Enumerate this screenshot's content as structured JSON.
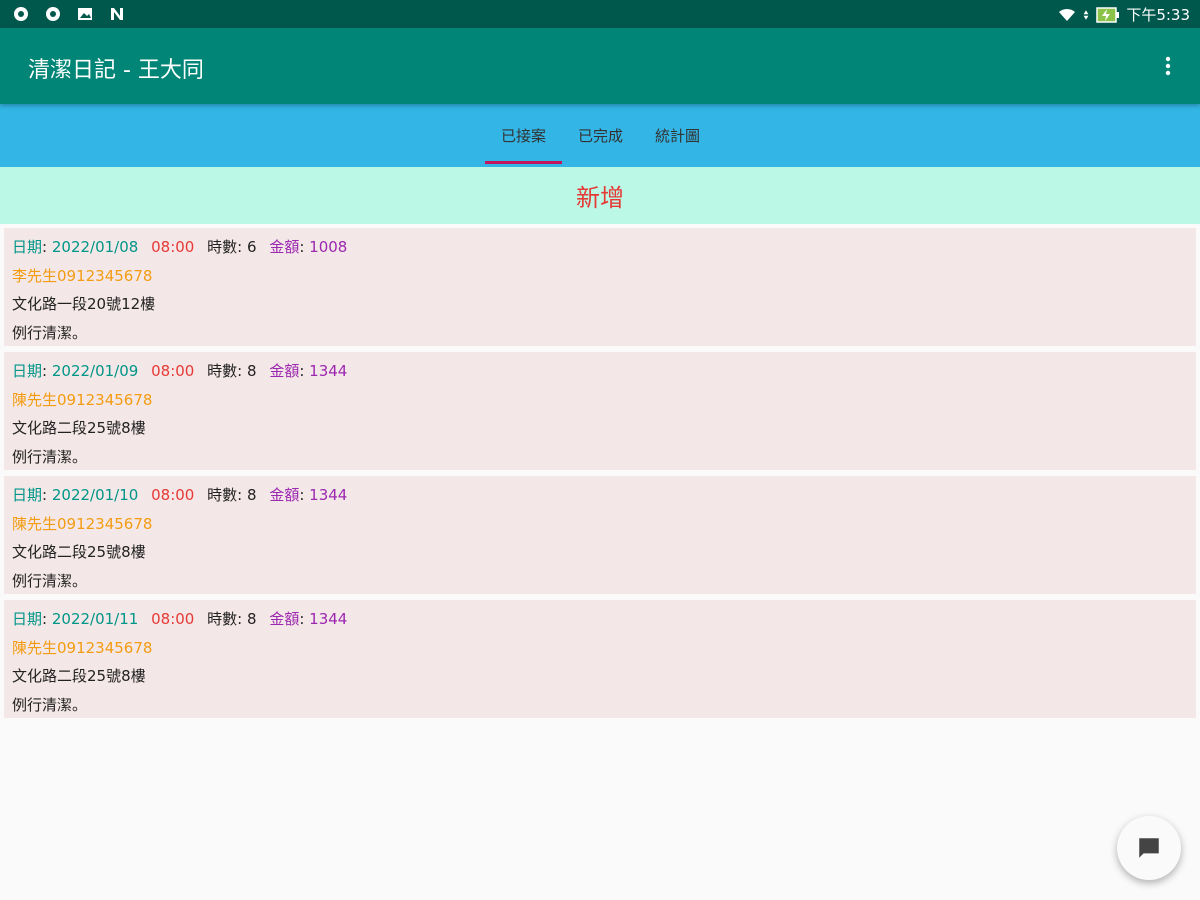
{
  "status_bar": {
    "time": "下午5:33",
    "left_icons": [
      "vpn-icon",
      "vpn-icon",
      "image-icon",
      "n-icon"
    ],
    "right_icons": [
      "wifi-icon",
      "signal-icon",
      "battery-charging-icon"
    ]
  },
  "app_bar": {
    "title": "清潔日記 - 王大同",
    "menu_icon": "more-vert-icon"
  },
  "tabs": [
    {
      "label": "已接案",
      "selected": true
    },
    {
      "label": "已完成",
      "selected": false
    },
    {
      "label": "統計圖",
      "selected": false
    }
  ],
  "add_button": {
    "label": "新增"
  },
  "labels": {
    "date": "日期",
    "hours": "時數",
    "amount": "金額",
    "colon": ":"
  },
  "cards": [
    {
      "date": "2022/01/08",
      "time": "08:00",
      "hours": "6",
      "amount": "1008",
      "contact": "李先生0912345678",
      "address": "文化路一段20號12樓",
      "note": "例行清潔。"
    },
    {
      "date": "2022/01/09",
      "time": "08:00",
      "hours": "8",
      "amount": "1344",
      "contact": "陳先生0912345678",
      "address": "文化路二段25號8樓",
      "note": "例行清潔。"
    },
    {
      "date": "2022/01/10",
      "time": "08:00",
      "hours": "8",
      "amount": "1344",
      "contact": "陳先生0912345678",
      "address": "文化路二段25號8樓",
      "note": "例行清潔。"
    },
    {
      "date": "2022/01/11",
      "time": "08:00",
      "hours": "8",
      "amount": "1344",
      "contact": "陳先生0912345678",
      "address": "文化路二段25號8樓",
      "note": "例行清潔。"
    }
  ],
  "fab": {
    "icon": "chat-icon"
  },
  "colors": {
    "status_bar": "#00574b",
    "app_bar": "#008577",
    "tab_bar": "#33b5e5",
    "tab_indicator": "#c2185b",
    "add_bar": "#bcf8e6",
    "add_text": "#e53935",
    "card_bg": "#f4e7e7",
    "date_text": "#009688",
    "time_text": "#e53935",
    "amount_text": "#9c27b0",
    "contact_text": "#f39c12"
  }
}
